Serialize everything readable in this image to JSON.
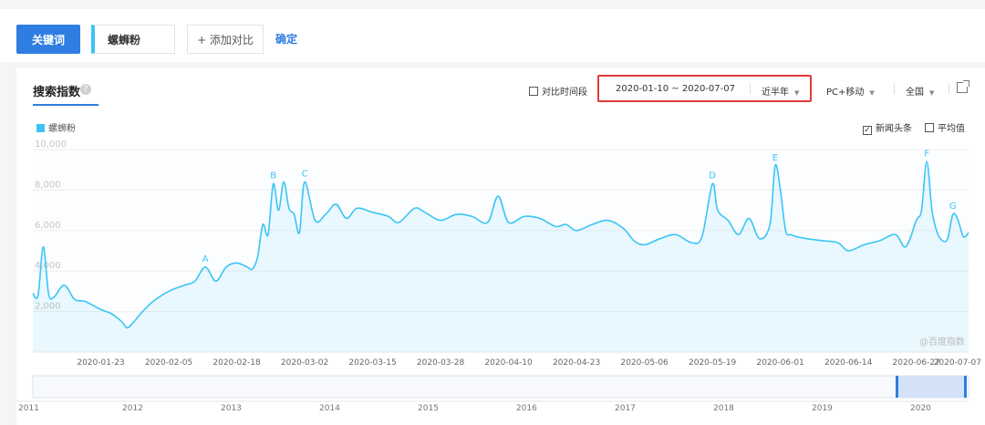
{
  "keyword_bar": {
    "keyword_button": "关键词",
    "keyword": "螺蛳粉",
    "add_compare": "+ 添加对比",
    "confirm": "确定"
  },
  "panel": {
    "tab_title": "搜索指数",
    "compare_period": "对比时间段",
    "date_range": "2020-01-10 ~ 2020-07-07",
    "date_preset": "近半年",
    "device": "PC+移动",
    "region": "全国",
    "news_option": "新闻头条",
    "avg_option": "平均值",
    "watermark": "@百度指数"
  },
  "colors": {
    "accent": "#2e7de1",
    "series": "#3cc4f5",
    "highlight": "#e23a3a"
  },
  "chart_data": {
    "type": "area",
    "ylim": [
      0,
      10000
    ],
    "yticks": [
      "10,000",
      "8,000",
      "6,000",
      "4,000",
      "2,000"
    ],
    "xticks": [
      "2020-01-23",
      "2020-02-05",
      "2020-02-18",
      "2020-03-02",
      "2020-03-15",
      "2020-03-28",
      "2020-04-10",
      "2020-04-23",
      "2020-05-06",
      "2020-05-19",
      "2020-06-01",
      "2020-06-14",
      "2020-06-27",
      "2020-07-07"
    ],
    "legend": [
      "螺蛳粉"
    ],
    "series": [
      {
        "name": "螺蛳粉",
        "x": [
          "2020-01-10",
          "2020-01-11",
          "2020-01-12",
          "2020-01-13",
          "2020-01-14",
          "2020-01-16",
          "2020-01-18",
          "2020-01-20",
          "2020-01-23",
          "2020-01-25",
          "2020-01-27",
          "2020-01-28",
          "2020-01-29",
          "2020-01-31",
          "2020-02-02",
          "2020-02-05",
          "2020-02-08",
          "2020-02-10",
          "2020-02-12",
          "2020-02-14",
          "2020-02-16",
          "2020-02-18",
          "2020-02-20",
          "2020-02-21",
          "2020-02-22",
          "2020-02-23",
          "2020-02-24",
          "2020-02-25",
          "2020-02-26",
          "2020-02-27",
          "2020-02-28",
          "2020-02-29",
          "2020-03-01",
          "2020-03-02",
          "2020-03-04",
          "2020-03-06",
          "2020-03-08",
          "2020-03-10",
          "2020-03-12",
          "2020-03-15",
          "2020-03-18",
          "2020-03-20",
          "2020-03-23",
          "2020-03-25",
          "2020-03-28",
          "2020-03-31",
          "2020-04-03",
          "2020-04-06",
          "2020-04-08",
          "2020-04-10",
          "2020-04-13",
          "2020-04-16",
          "2020-04-19",
          "2020-04-21",
          "2020-04-23",
          "2020-04-26",
          "2020-04-29",
          "2020-05-02",
          "2020-05-04",
          "2020-05-06",
          "2020-05-09",
          "2020-05-12",
          "2020-05-15",
          "2020-05-17",
          "2020-05-19",
          "2020-05-20",
          "2020-05-22",
          "2020-05-24",
          "2020-05-26",
          "2020-05-28",
          "2020-05-30",
          "2020-05-31",
          "2020-06-01",
          "2020-06-02",
          "2020-06-03",
          "2020-06-04",
          "2020-06-06",
          "2020-06-09",
          "2020-06-12",
          "2020-06-14",
          "2020-06-17",
          "2020-06-20",
          "2020-06-23",
          "2020-06-25",
          "2020-06-27",
          "2020-06-28",
          "2020-06-29",
          "2020-06-30",
          "2020-07-01",
          "2020-07-02",
          "2020-07-03",
          "2020-07-04",
          "2020-07-05",
          "2020-07-06",
          "2020-07-07"
        ],
        "values": [
          2900,
          2800,
          5200,
          2900,
          2700,
          3300,
          2600,
          2500,
          2100,
          1900,
          1500,
          1200,
          1400,
          2000,
          2500,
          3000,
          3300,
          3500,
          4200,
          3500,
          4200,
          4400,
          4200,
          4100,
          4700,
          6300,
          5800,
          8300,
          7000,
          8400,
          7100,
          6800,
          5900,
          8400,
          6500,
          6800,
          7300,
          6600,
          7100,
          6900,
          6700,
          6400,
          7100,
          6900,
          6500,
          6800,
          6700,
          6400,
          7700,
          6400,
          6700,
          6600,
          6200,
          6300,
          6000,
          6300,
          6500,
          6100,
          5500,
          5300,
          5600,
          5800,
          5400,
          5700,
          8300,
          7000,
          6500,
          5800,
          6600,
          5600,
          6300,
          9200,
          8000,
          6000,
          5800,
          5700,
          5600,
          5500,
          5400,
          5000,
          5300,
          5500,
          5800,
          5200,
          6500,
          7000,
          9400,
          7000,
          5900,
          5500,
          5600,
          6800,
          6500,
          5700,
          5900
        ]
      }
    ],
    "annotations": [
      {
        "label": "A",
        "x": "2020-02-12",
        "y": 4200
      },
      {
        "label": "B",
        "x": "2020-02-25",
        "y": 8300
      },
      {
        "label": "C",
        "x": "2020-03-02",
        "y": 8400
      },
      {
        "label": "D",
        "x": "2020-05-19",
        "y": 8300
      },
      {
        "label": "E",
        "x": "2020-05-31",
        "y": 9200
      },
      {
        "label": "F",
        "x": "2020-06-29",
        "y": 9400
      },
      {
        "label": "G",
        "x": "2020-07-04",
        "y": 6800
      }
    ],
    "navigator": {
      "years": [
        "2011",
        "2012",
        "2013",
        "2014",
        "2015",
        "2016",
        "2017",
        "2018",
        "2019",
        "2020"
      ],
      "selection": [
        "2020-01-10",
        "2020-07-07"
      ]
    }
  }
}
